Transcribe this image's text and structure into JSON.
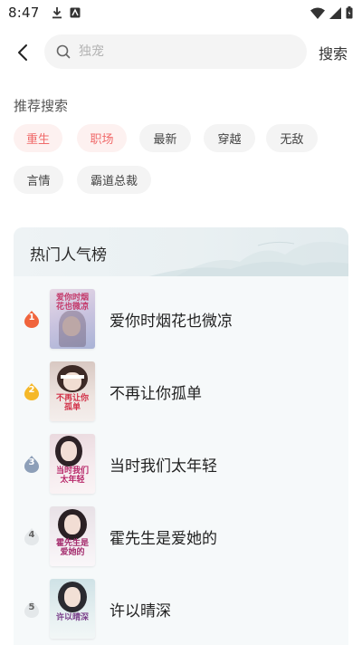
{
  "status_bar": {
    "time": "8:47"
  },
  "search": {
    "placeholder": "独宠",
    "submit_label": "搜索"
  },
  "recommend": {
    "title": "推荐搜索",
    "tags": [
      "重生",
      "职场",
      "最新",
      "穿越",
      "无敌",
      "言情",
      "霸道总裁"
    ]
  },
  "ranking": {
    "title": "热门人气榜",
    "items": [
      {
        "rank": "1",
        "title": "爱你时烟花也微凉",
        "cover_text": "爱你时烟花也微凉"
      },
      {
        "rank": "2",
        "title": "不再让你孤单",
        "cover_text": "不再让你孤单"
      },
      {
        "rank": "3",
        "title": "当时我们太年轻",
        "cover_text": "当时我们太年轻"
      },
      {
        "rank": "4",
        "title": "霍先生是爱她的",
        "cover_text": "霍先生是爱她的"
      },
      {
        "rank": "5",
        "title": "许以晴深",
        "cover_text": "许以晴深"
      }
    ]
  },
  "colors": {
    "hot_tag_text": "#f06a6a",
    "hot_tag_bg": "#fdf1f0",
    "rank_1": "#f0643c",
    "rank_2": "#f5b829",
    "rank_3": "#8d9fb8"
  }
}
